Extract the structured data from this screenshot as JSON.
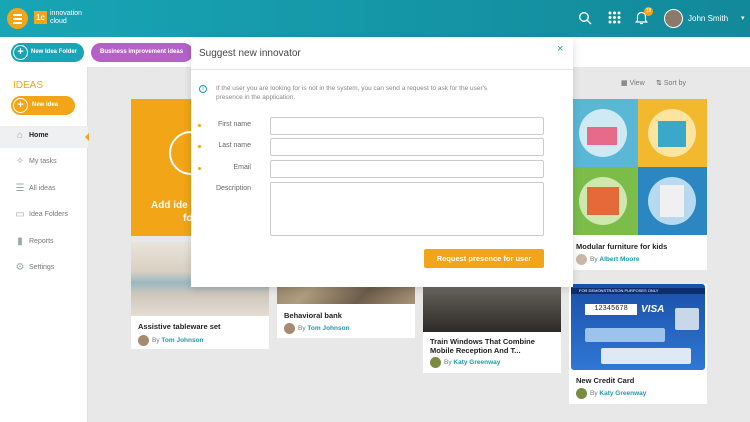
{
  "brand": {
    "logo_mark": "1c",
    "name": "innovation cloud",
    "accent": "#f2a516",
    "primary": "#18a5b5",
    "purple": "#b462c8"
  },
  "topbar": {
    "user_name": "John Smith",
    "notification_count": "18",
    "icons": [
      "search-icon",
      "apps-grid-icon",
      "bell-icon"
    ]
  },
  "toolbar": {
    "new_folder_label": "New Idea Folder",
    "business_label": "Business improvement ideas"
  },
  "sidebar": {
    "title": "IDEAS",
    "new_idea_label": "New idea",
    "items": [
      {
        "label": "Home",
        "icon": "home-icon",
        "active": true
      },
      {
        "label": "My tasks",
        "icon": "magic-wand-icon"
      },
      {
        "label": "All ideas",
        "icon": "list-icon"
      },
      {
        "label": "Idea Folders",
        "icon": "folder-icon"
      },
      {
        "label": "Reports",
        "icon": "bar-chart-icon"
      },
      {
        "label": "Settings",
        "icon": "gear-icon"
      }
    ]
  },
  "view": {
    "view_label": "View",
    "sort_label": "Sort by"
  },
  "add_idea": {
    "line1": "Add ide",
    "line2": "fo"
  },
  "cards": [
    {
      "title": "Assistive tableware set",
      "by": "By",
      "author": "Tom Johnson"
    },
    {
      "title": "Behavioral bank",
      "by": "By",
      "author": "Tom Johnson"
    },
    {
      "title": "Train Windows That Combine Mobile Reception And T...",
      "by": "By",
      "author": "Katy Greenway"
    },
    {
      "title": "Modular furniture for kids",
      "by": "By",
      "author": "Albert Moore"
    },
    {
      "title": "New Credit Card",
      "by": "By",
      "author": "Katy Greenway"
    }
  ],
  "credit_card": {
    "banner": "FOR DEMONSTRATION PURPOSES ONLY",
    "number": "12345678",
    "brand": "VISA"
  },
  "modal": {
    "title": "Suggest new innovator",
    "close": "×",
    "info_icon": "i",
    "info": "If the user you are looking for is not in the system, you can send a request to ask for the user's presence in the application.",
    "first_name_label": "First name",
    "last_name_label": "Last name",
    "email_label": "Email",
    "description_label": "Description",
    "first_name_value": "",
    "last_name_value": "",
    "email_value": "",
    "description_value": "",
    "submit_label": "Request presence for user"
  }
}
